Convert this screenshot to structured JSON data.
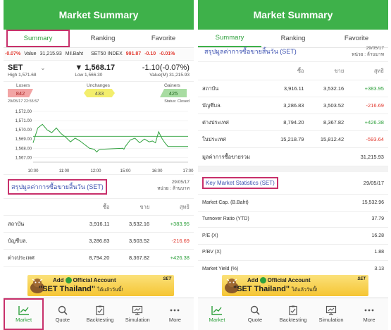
{
  "header_title": "Market Summary",
  "tabs": [
    "Summary",
    "Ranking",
    "Favorite"
  ],
  "ticker": {
    "change_pct": "-0.07%",
    "value_label": "Value",
    "value": "31,215.93",
    "value_unit": "Mil.Baht",
    "index_name": "SET50 INDEX",
    "index_value": "991.87",
    "index_change": "-0.10",
    "index_pct": "-0.01%"
  },
  "quote": {
    "symbol": "SET",
    "high_text": "High 1,571.68",
    "price": "1,568.17",
    "low_text": "Low 1,566.30",
    "change": "-1.10(-0.07%)",
    "value_text": "Value(M) 31,215.93"
  },
  "breadth": {
    "losers_label": "Losers",
    "losers": "842",
    "unchanged_label": "Unchanges",
    "unchanged": "433",
    "gainers_label": "Gainers",
    "gainers": "425",
    "timestamp": "29/05/17 22:55:57",
    "status": "Status: Closed"
  },
  "chart_data": {
    "type": "line",
    "y_ticks": [
      "1,572.00",
      "1,571.00",
      "1,570.00",
      "1,569.00",
      "1,568.00",
      "1,567.00"
    ],
    "x_ticks": [
      "10:00",
      "11:00",
      "12:00",
      "15:00",
      "16:00",
      "17:00"
    ],
    "ylim": [
      1566.5,
      1572.3
    ],
    "series": [
      {
        "x": [
          10.0,
          10.15,
          10.3,
          10.45,
          10.6,
          10.75,
          10.9,
          11.05,
          11.2,
          11.35,
          11.5,
          11.65,
          11.8,
          11.95,
          12.1,
          12.25,
          12.5,
          14.75,
          14.85,
          15.0,
          15.15,
          15.3,
          15.45,
          15.6,
          15.75,
          15.85,
          15.95,
          16.05,
          16.15,
          16.25,
          16.35,
          16.5,
          16.75,
          17.0
        ],
        "y": [
          1568.6,
          1570.2,
          1570.6,
          1570.0,
          1569.7,
          1570.2,
          1569.6,
          1569.2,
          1568.7,
          1569.1,
          1568.8,
          1568.4,
          1568.0,
          1567.9,
          1567.6,
          1567.8,
          1567.9,
          1568.0,
          1567.9,
          1568.2,
          1568.9,
          1569.1,
          1568.6,
          1569.0,
          1568.7,
          1568.8,
          1568.6,
          1569.8,
          1569.1,
          1568.6,
          1568.2,
          1568.2,
          1568.2,
          1568.2
        ]
      },
      {
        "x": [
          10.0,
          17.0
        ],
        "y": [
          1569.3,
          1569.3
        ]
      }
    ]
  },
  "section_title": "สรุปมูลค่าการซื้อขายสิ้นวัน (SET)",
  "section_date": "29/05/17",
  "section_unit": "หน่วย : ล้านบาท",
  "table": {
    "headers": [
      "",
      "ซื้อ",
      "ขาย",
      "สุทธิ"
    ],
    "rows": [
      {
        "name": "สถาบัน",
        "buy": "3,916.11",
        "sell": "3,532.16",
        "net": "+383.95"
      },
      {
        "name": "บัญชีบล.",
        "buy": "3,286.83",
        "sell": "3,503.52",
        "net": "-216.69"
      },
      {
        "name": "ต่างประเทศ",
        "buy": "8,794.20",
        "sell": "8,367.82",
        "net": "+426.38"
      },
      {
        "name": "ในประเทศ",
        "buy": "15,218.79",
        "sell": "15,812.42",
        "net": "-593.64"
      }
    ],
    "total_label": "มูลค่าการซื้อขายรวม",
    "total_value": "31,215.93"
  },
  "key_stats": {
    "title": "Key Market Statistics (SET)",
    "date": "29/05/17",
    "rows": [
      {
        "label": "Market Cap. (B.Baht)",
        "value": "15,532.96"
      },
      {
        "label": "Turnover Ratio (YTD)",
        "value": "37.79"
      },
      {
        "label": "P/E (X)",
        "value": "16.28"
      },
      {
        "label": "P/BV (X)",
        "value": "1.88"
      },
      {
        "label": "Market Yield (%)",
        "value": "3.13"
      }
    ]
  },
  "banner": {
    "add_text": "Add",
    "official_text": "Official Account",
    "handle": "\"SET Thailand\"",
    "suffix": "ได้แล้ววันนี้!",
    "logo_text": "SET"
  },
  "nav": [
    {
      "label": "Market",
      "icon": "chart-icon"
    },
    {
      "label": "Quote",
      "icon": "search-icon"
    },
    {
      "label": "Backtesting",
      "icon": "clipboard-icon"
    },
    {
      "label": "Simulation",
      "icon": "monitor-icon"
    },
    {
      "label": "More",
      "icon": "more-icon"
    }
  ],
  "colors": {
    "brand_green": "#3eb14a",
    "highlight_box": "#c8306b",
    "negative": "#e2392f",
    "positive": "#2ea03c",
    "link_blue": "#3a4fb0"
  }
}
